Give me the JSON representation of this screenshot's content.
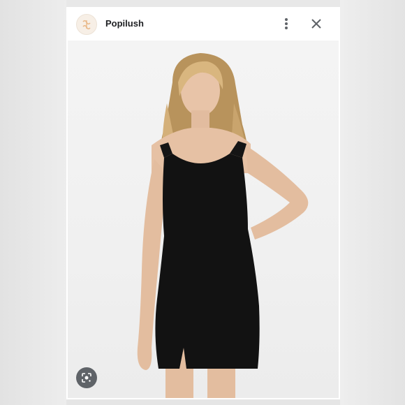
{
  "app": {
    "name": "Popilush",
    "logo_icon": "popilush-logo-icon"
  },
  "header": {
    "menu_icon": "more-vertical-icon",
    "close_icon": "close-icon"
  },
  "image": {
    "subject": "product-photo",
    "lens_icon": "google-lens-icon"
  },
  "colors": {
    "accent": "#e9b98a",
    "dress": "#121212",
    "background": "#f0f0f0"
  }
}
